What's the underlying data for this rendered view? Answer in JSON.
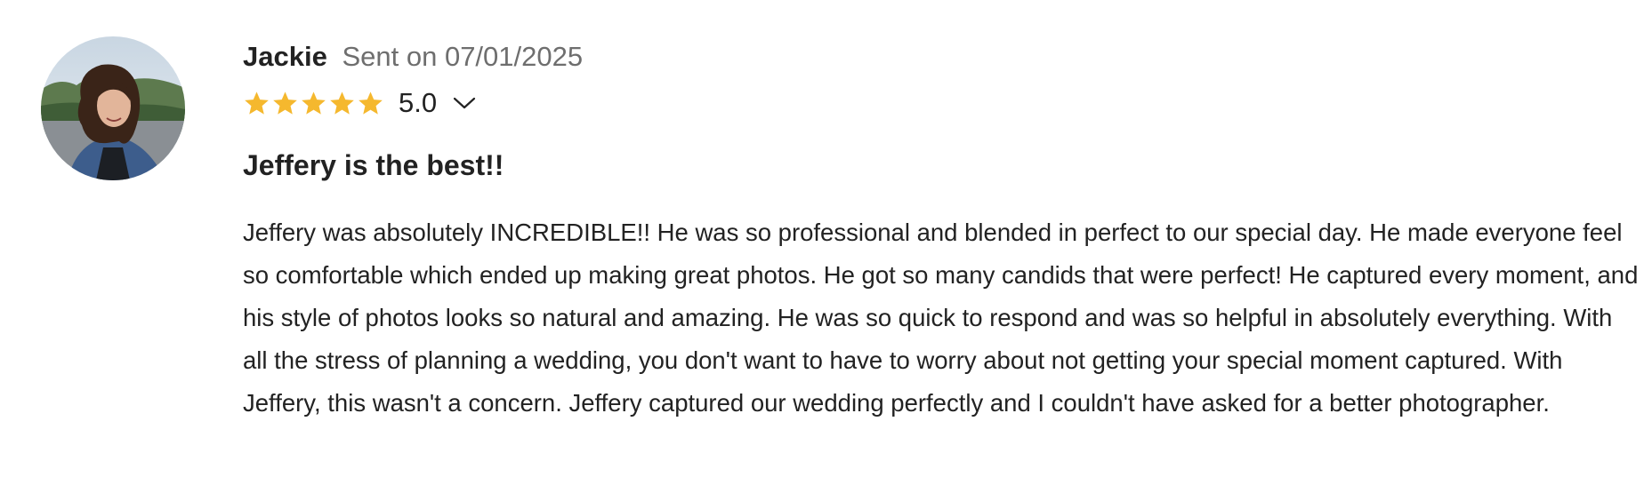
{
  "review": {
    "author": "Jackie",
    "sent_label": "Sent on",
    "sent_date": "07/01/2025",
    "rating": "5.0",
    "rating_stars": 5,
    "star_color": "#f5b82e",
    "title": "Jeffery is the best!!",
    "body": "Jeffery was absolutely INCREDIBLE!! He was so professional and blended in perfect to our special day. He made everyone feel so comfortable which ended up making great photos. He got so many candids that were perfect! He captured every moment, and his style of photos looks so natural and amazing. He was so quick to respond and was so helpful in absolutely everything. With all the stress of planning a wedding, you don't want to have to worry about not getting your special moment captured. With Jeffery, this wasn't a concern. Jeffery captured our wedding perfectly and I couldn't have asked for a better photographer.",
    "icons": {
      "avatar": "avatar-photo",
      "star": "star-icon",
      "expand": "chevron-down-icon"
    }
  }
}
